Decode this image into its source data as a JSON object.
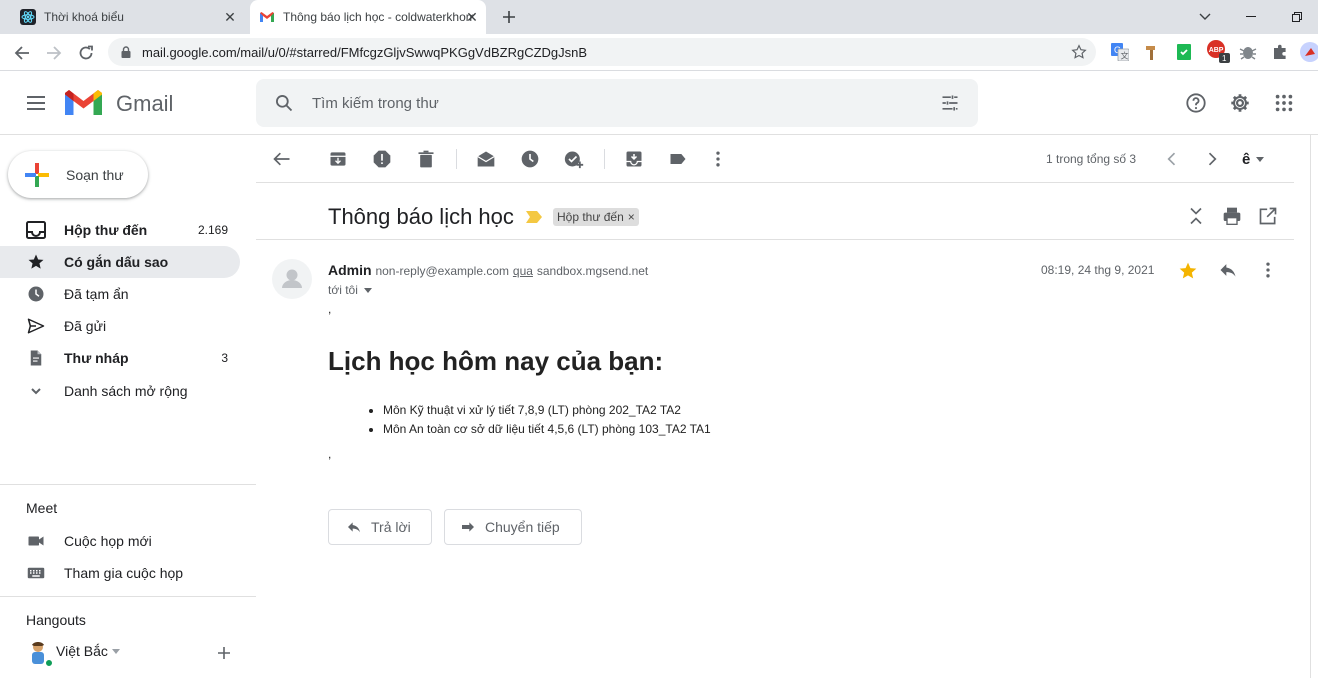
{
  "browser": {
    "tabs": [
      {
        "title": "Thời khoá biểu",
        "icon": "react-icon"
      },
      {
        "title": "Thông báo lịch học - coldwaterkhomage@gmail.com",
        "icon": "gmail-icon",
        "active": true
      }
    ],
    "url": "mail.google.com/mail/u/0/#starred/FMfcgzGljvSwwqPKGgVdBZRgCZDgJsnB",
    "extensions": [
      "translate-icon",
      "hammer-icon",
      "bookmark-icon",
      "adblock-icon",
      "bug-icon",
      "puzzle-icon",
      "profile-icon"
    ],
    "adblock_badge": "1",
    "adblock_label": "ABP"
  },
  "gmail": {
    "app_name": "Gmail",
    "search_placeholder": "Tìm kiếm trong thư",
    "compose_label": "Soạn thư",
    "sidebar": {
      "items": [
        {
          "label": "Hộp thư đến",
          "count": "2.169",
          "icon": "inbox-icon",
          "bold": true
        },
        {
          "label": "Có gắn dấu sao",
          "count": "",
          "icon": "star-icon",
          "bold": true,
          "active": true
        },
        {
          "label": "Đã tạm ẩn",
          "count": "",
          "icon": "clock-icon"
        },
        {
          "label": "Đã gửi",
          "count": "",
          "icon": "send-icon"
        },
        {
          "label": "Thư nháp",
          "count": "3",
          "icon": "draft-icon",
          "bold": true
        },
        {
          "label": "Danh sách mở rộng",
          "count": "",
          "icon": "chevron-down-icon"
        }
      ],
      "meet_title": "Meet",
      "meet_items": [
        {
          "label": "Cuộc họp mới",
          "icon": "videocam-icon"
        },
        {
          "label": "Tham gia cuộc họp",
          "icon": "keyboard-icon"
        }
      ],
      "hangouts_title": "Hangouts",
      "hangouts_user": "Việt Bắc"
    },
    "toolbar": {
      "page_info": "1 trong tổng số 3",
      "input_tool": "ê"
    },
    "message": {
      "subject": "Thông báo lịch học",
      "label_chip": "Hộp thư đến",
      "label_chip_close": "×",
      "sender_name": "Admin",
      "sender_email": "non-reply@example.com",
      "via_label": "qua",
      "via_domain": "sandbox.mgsend.net",
      "to_label": "tới tôi",
      "date": "08:19, 24 thg 9, 2021",
      "body_comma_top": ",",
      "body_heading": "Lịch học hôm nay của bạn:",
      "body_items": [
        "Môn Kỹ thuật vi xử lý tiết 7,8,9 (LT) phòng 202_TA2 TA2",
        "Môn An toàn cơ sở dữ liệu tiết 4,5,6 (LT) phòng 103_TA2 TA1"
      ],
      "body_comma_bottom": ",",
      "reply_label": "Trả lời",
      "forward_label": "Chuyển tiếp"
    }
  },
  "colors": {
    "chrome_tabbar": "#dee1e6",
    "active_nav": "#e8eaed",
    "important_marker": "#f4c842",
    "star_gold": "#f4b400",
    "online": "#0f9d58"
  }
}
